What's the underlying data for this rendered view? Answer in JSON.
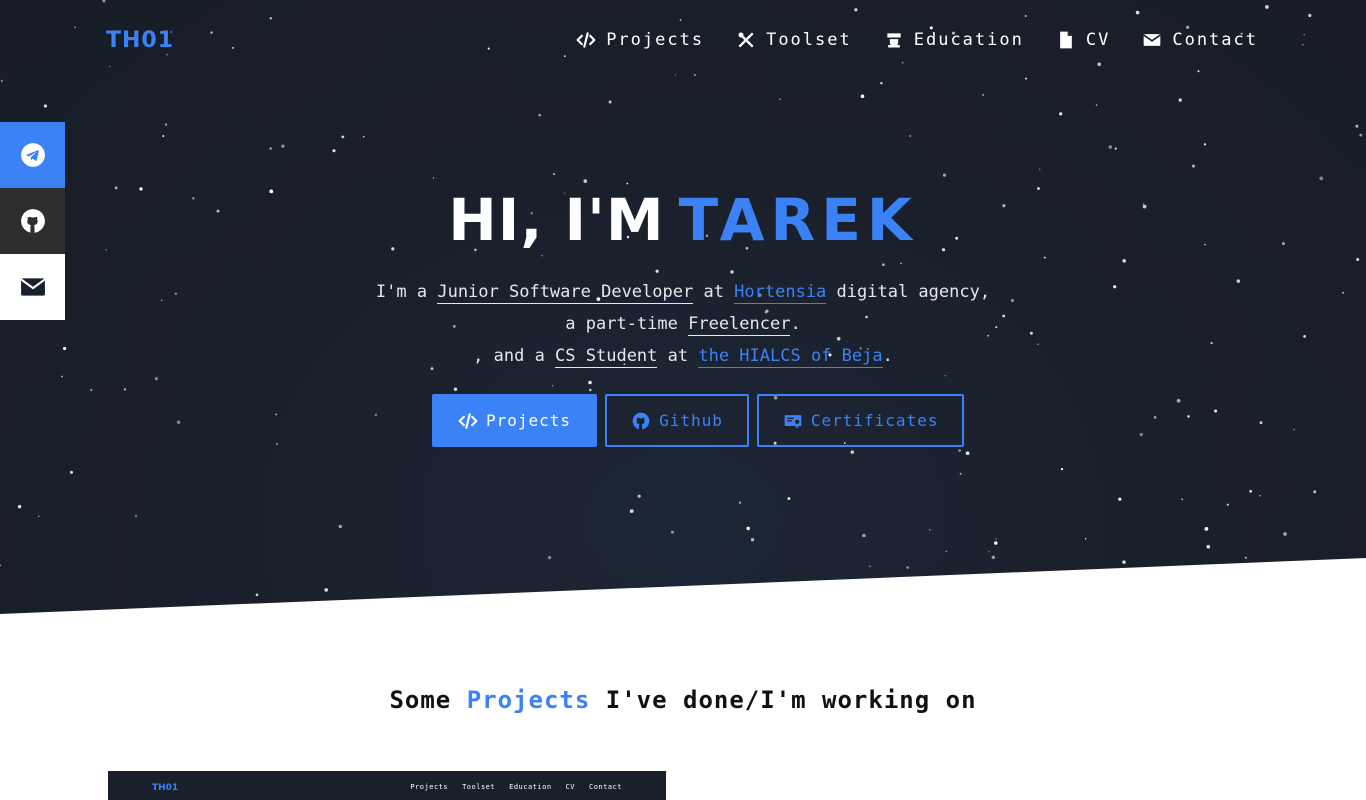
{
  "brand": {
    "logo": "TH01",
    "accent": "#3b82f6",
    "dark_bg": "#1a202b"
  },
  "nav": [
    {
      "label": "Projects",
      "icon": "code-icon"
    },
    {
      "label": "Toolset",
      "icon": "tools-icon"
    },
    {
      "label": "Education",
      "icon": "graduation-icon"
    },
    {
      "label": "CV",
      "icon": "file-icon"
    },
    {
      "label": "Contact",
      "icon": "envelope-icon"
    }
  ],
  "social": [
    {
      "name": "telegram",
      "icon": "telegram-icon"
    },
    {
      "name": "github",
      "icon": "github-icon"
    },
    {
      "name": "mail",
      "icon": "envelope-icon"
    }
  ],
  "hero": {
    "greeting": "HI, I'M",
    "name": "TAREK",
    "intro": {
      "t1": "I'm a ",
      "role": "Junior Software Developer",
      "t2": " at ",
      "company": "Hortensia",
      "t3": " digital agency,",
      "t4": "a part-time ",
      "freelancer": "Freelencer",
      "t5": ".",
      "t6": ", and a ",
      "student": "CS Student",
      "t7": " at ",
      "school": "the HIALCS of Beja",
      "t8": "."
    },
    "buttons": [
      {
        "label": "Projects",
        "icon": "code-icon"
      },
      {
        "label": "Github",
        "icon": "github-icon"
      },
      {
        "label": "Certificates",
        "icon": "certificate-icon"
      }
    ]
  },
  "projects_section": {
    "title_pre": "Some ",
    "title_accent": "Projects",
    "title_post": " I've done/I'm working on"
  },
  "thumbnail": {
    "logo": "TH01",
    "nav": [
      "Projects",
      "Toolset",
      "Education",
      "CV",
      "Contact"
    ]
  }
}
